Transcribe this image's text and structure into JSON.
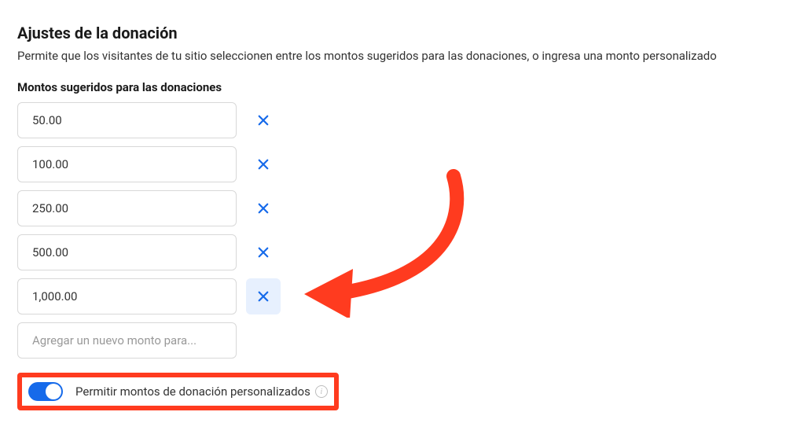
{
  "section": {
    "title": "Ajustes de la donación",
    "description": "Permite que los visitantes de tu sitio seleccionen entre los montos sugeridos para las donaciones, o ingresa una monto personalizado"
  },
  "suggested": {
    "label": "Montos sugeridos para las donaciones",
    "values": [
      "50.00",
      "100.00",
      "250.00",
      "500.00",
      "1,000.00"
    ],
    "add_placeholder": "Agregar un nuevo monto para..."
  },
  "toggle": {
    "custom_label": "Permitir montos de donación personalizados",
    "on": true
  },
  "annotation": {
    "arrow_color": "#ff3b1f",
    "highlight_color": "#ff3b1f"
  }
}
